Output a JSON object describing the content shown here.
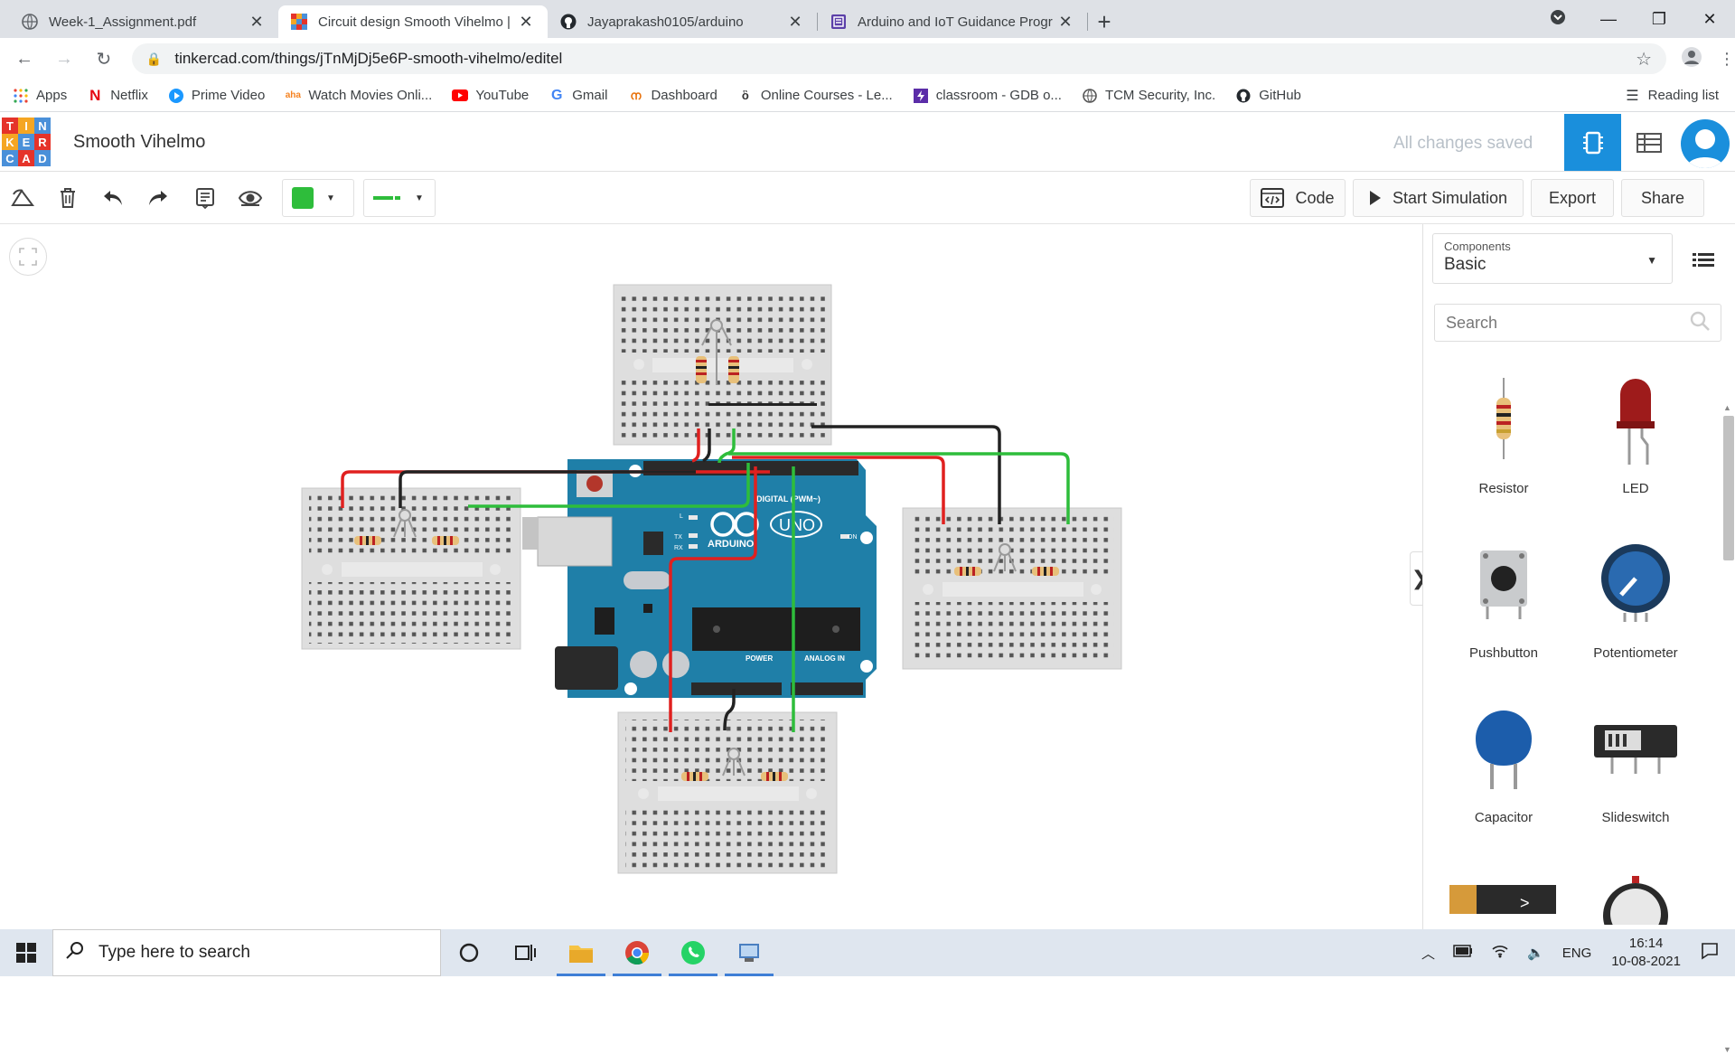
{
  "tabs": [
    {
      "title": "Week-1_Assignment.pdf",
      "active": false
    },
    {
      "title": "Circuit design Smooth Vihelmo | ",
      "active": true
    },
    {
      "title": "Jayaprakash0105/arduino",
      "active": false
    },
    {
      "title": "Arduino and IoT Guidance Progr",
      "active": false
    }
  ],
  "address": {
    "url": "tinkercad.com/things/jTnMjDj5e6P-smooth-vihelmo/editel"
  },
  "bookmarks": [
    {
      "label": "Apps",
      "icon": "apps-icon"
    },
    {
      "label": "Netflix",
      "icon": "netflix-icon"
    },
    {
      "label": "Prime Video",
      "icon": "prime-video-icon"
    },
    {
      "label": "Watch Movies Onli...",
      "icon": "movies-icon"
    },
    {
      "label": "YouTube",
      "icon": "youtube-icon"
    },
    {
      "label": "Gmail",
      "icon": "google-icon"
    },
    {
      "label": "Dashboard",
      "icon": "dashboard-icon"
    },
    {
      "label": "Online Courses - Le...",
      "icon": "courses-icon"
    },
    {
      "label": "classroom - GDB o...",
      "icon": "classroom-icon"
    },
    {
      "label": "TCM Security, Inc.",
      "icon": "tcm-icon"
    },
    {
      "label": "GitHub",
      "icon": "github-icon"
    }
  ],
  "reading_list": "Reading list",
  "tinkercad": {
    "logo_letters": [
      "T",
      "I",
      "N",
      "K",
      "E",
      "R",
      "C",
      "A",
      "D"
    ],
    "logo_colors": [
      "#e5332a",
      "#f5a623",
      "#4a90d9",
      "#f5a623",
      "#4a90d9",
      "#e5332a",
      "#4a90d9",
      "#e5332a",
      "#4a90d9"
    ],
    "design_title": "Smooth Vihelmo",
    "save_status": "All changes saved"
  },
  "toolbar": {
    "color_swatch": "#2ebd3b",
    "code_label": "Code",
    "simulate_label": "Start Simulation",
    "export_label": "Export",
    "share_label": "Share"
  },
  "panel": {
    "components_label": "Components",
    "components_value": "Basic",
    "search_placeholder": "Search",
    "items": [
      {
        "name": "Resistor",
        "icon": "resistor-icon"
      },
      {
        "name": "LED",
        "icon": "led-icon"
      },
      {
        "name": "Pushbutton",
        "icon": "pushbutton-icon"
      },
      {
        "name": "Potentiometer",
        "icon": "potentiometer-icon"
      },
      {
        "name": "Capacitor",
        "icon": "capacitor-icon"
      },
      {
        "name": "Slideswitch",
        "icon": "slideswitch-icon"
      }
    ]
  },
  "board": {
    "brand": "ARDUINO",
    "model": "UNO",
    "digital_label": "DIGITAL (PWM~)",
    "power_label": "POWER",
    "analog_label": "ANALOG IN",
    "on_label": "ON",
    "tx_label": "TX",
    "rx_label": "RX",
    "l_label": "L"
  },
  "taskbar": {
    "search_placeholder": "Type here to search",
    "lang": "ENG",
    "time": "16:14",
    "date": "10-08-2021"
  },
  "colors": {
    "accent": "#1a8fdc",
    "wire_red": "#e0201f",
    "wire_black": "#222222",
    "wire_green": "#2ebd3b",
    "arduino_blue": "#1f7fa8"
  }
}
